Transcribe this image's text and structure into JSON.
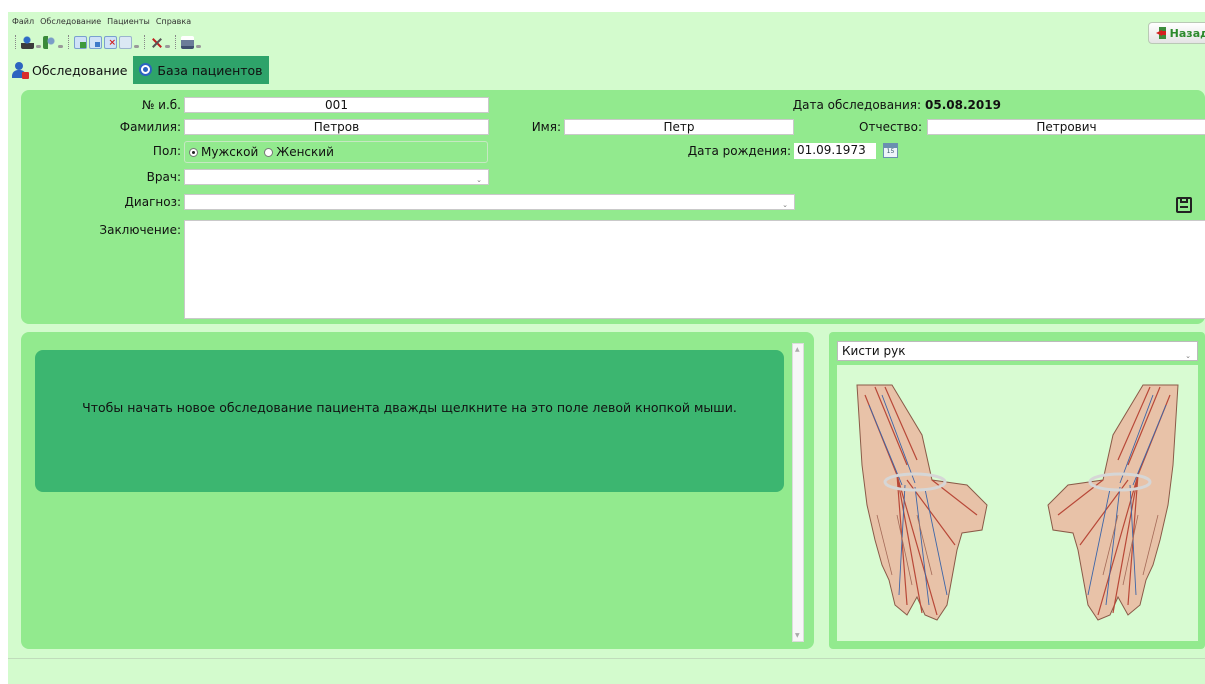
{
  "menu": [
    "Файл",
    "Обследование",
    "Пациенты",
    "Справка"
  ],
  "back_button": "Назад",
  "tabs": [
    {
      "label": "Обследование",
      "active": true
    },
    {
      "label": "База пациентов",
      "active": false
    }
  ],
  "form": {
    "record_no": {
      "label": "№ и.б.",
      "value": "001"
    },
    "exam_date": {
      "label": "Дата обследования:",
      "value": "05.08.2019"
    },
    "surname": {
      "label": "Фамилия:",
      "value": "Петров"
    },
    "name": {
      "label": "Имя:",
      "value": "Петр"
    },
    "patronymic": {
      "label": "Отчество:",
      "value": "Петрович"
    },
    "sex": {
      "label": "Пол:",
      "options": [
        "Мужской",
        "Женский"
      ],
      "selected": "Мужской"
    },
    "birth_date": {
      "label": "Дата рождения:",
      "value": "01.09.1973"
    },
    "doctor": {
      "label": "Врач:",
      "value": ""
    },
    "diagnosis": {
      "label": "Диагноз:",
      "value": ""
    },
    "conclusion": {
      "label": "Заключение:",
      "value": ""
    }
  },
  "calendar_icon_text": "15",
  "hint_text": "Чтобы начать новое обследование пациента дважды щелкните на это поле левой кнопкой мыши.",
  "body_part_select": "Кисти рук",
  "colors": {
    "app_bg": "#d3fbcd",
    "panel_bg": "#92ea8e",
    "hint_bg": "#3cb670",
    "tab_inactive": "#2ea36a"
  },
  "icons": [
    "user-add-icon",
    "user-back-icon",
    "add-doc-icon",
    "save-doc-icon",
    "delete-doc-icon",
    "edit-doc-icon",
    "tools-icon",
    "print-icon",
    "calendar-icon",
    "save-icon"
  ]
}
